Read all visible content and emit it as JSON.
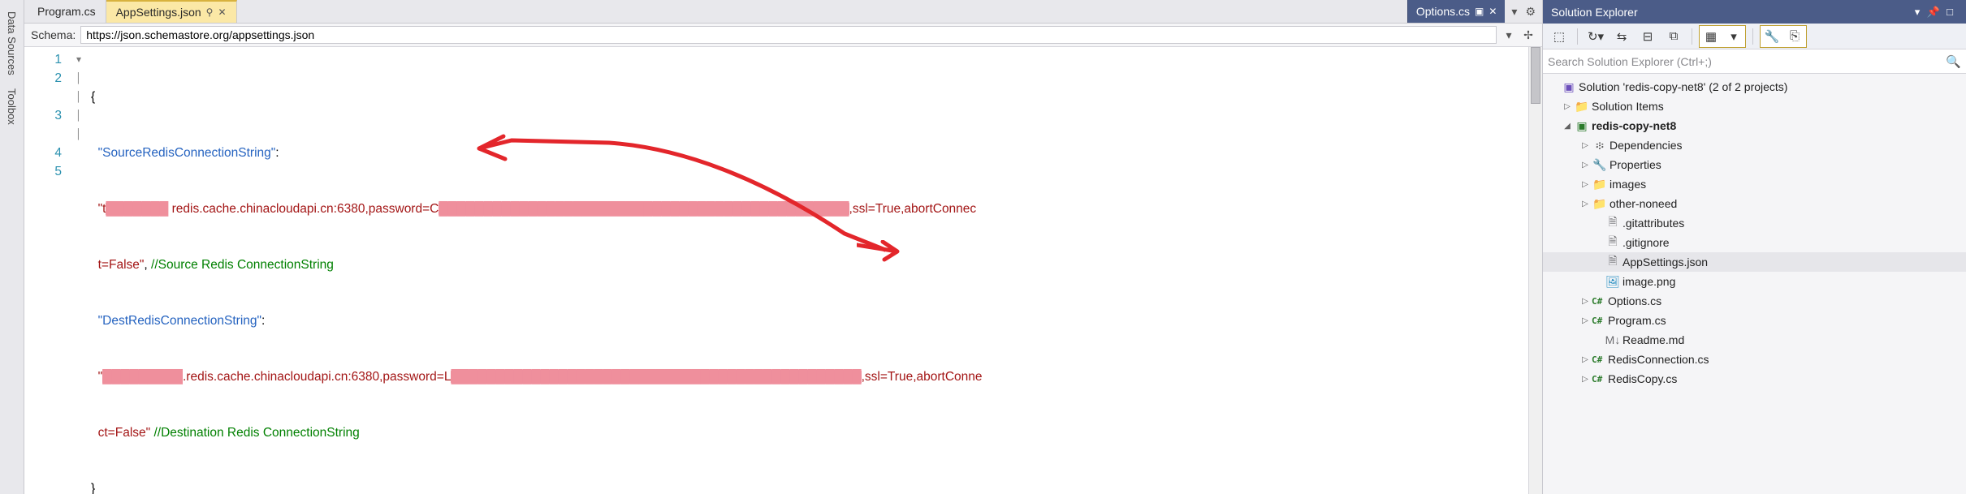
{
  "rails": {
    "data_sources": "Data Sources",
    "toolbox": "Toolbox"
  },
  "tabs": {
    "left": [
      {
        "label": "Program.cs",
        "active": false
      },
      {
        "label": "AppSettings.json",
        "active": true
      }
    ],
    "right": [
      {
        "label": "Options.cs"
      }
    ]
  },
  "schema": {
    "label": "Schema:",
    "value": "https://json.schemastore.org/appsettings.json"
  },
  "code": {
    "line_numbers": [
      "1",
      "2",
      "3",
      "4",
      "5"
    ],
    "l1_brace": "{",
    "key_src": "\"SourceRedisConnectionString\"",
    "colon": ":",
    "str_open": "\"t",
    "src_redact1": "███████",
    "src_mid1": " redis.cache.chinacloudapi.cn:6380,password=C",
    "src_redact2": "██████████████████████████████████████████████",
    "src_mid2": ",ssl=True,abortConnec",
    "src_tail": "t=False\"",
    "comma": ",",
    "comment_src": "//Source Redis ConnectionString",
    "key_dst": "\"DestRedisConnectionString\"",
    "dst_open": "\"",
    "dst_redact1": "█████████",
    "dst_mid1": ".redis.cache.chinacloudapi.cn:6380,password=L",
    "dst_redact2": "██████████████████████████████████████████████",
    "dst_mid2": ",ssl=True,abortConne",
    "dst_tail": "ct=False\"",
    "comment_dst": "//Destination Redis ConnectionString",
    "l4_brace": "}"
  },
  "solution_explorer": {
    "title": "Solution Explorer",
    "search_placeholder": "Search Solution Explorer (Ctrl+;)",
    "root": "Solution 'redis-copy-net8' (2 of 2 projects)",
    "tree": {
      "solution_items": "Solution Items",
      "project": "redis-copy-net8",
      "deps": "Dependencies",
      "props": "Properties",
      "images": "images",
      "other": "other-noneed",
      "gitattributes": ".gitattributes",
      "gitignore": ".gitignore",
      "appsettings": "AppSettings.json",
      "imagepng": "image.png",
      "options": "Options.cs",
      "program": "Program.cs",
      "readme": "Readme.md",
      "redisconn": "RedisConnection.cs",
      "rediscopy": "RedisCopy.cs"
    }
  }
}
